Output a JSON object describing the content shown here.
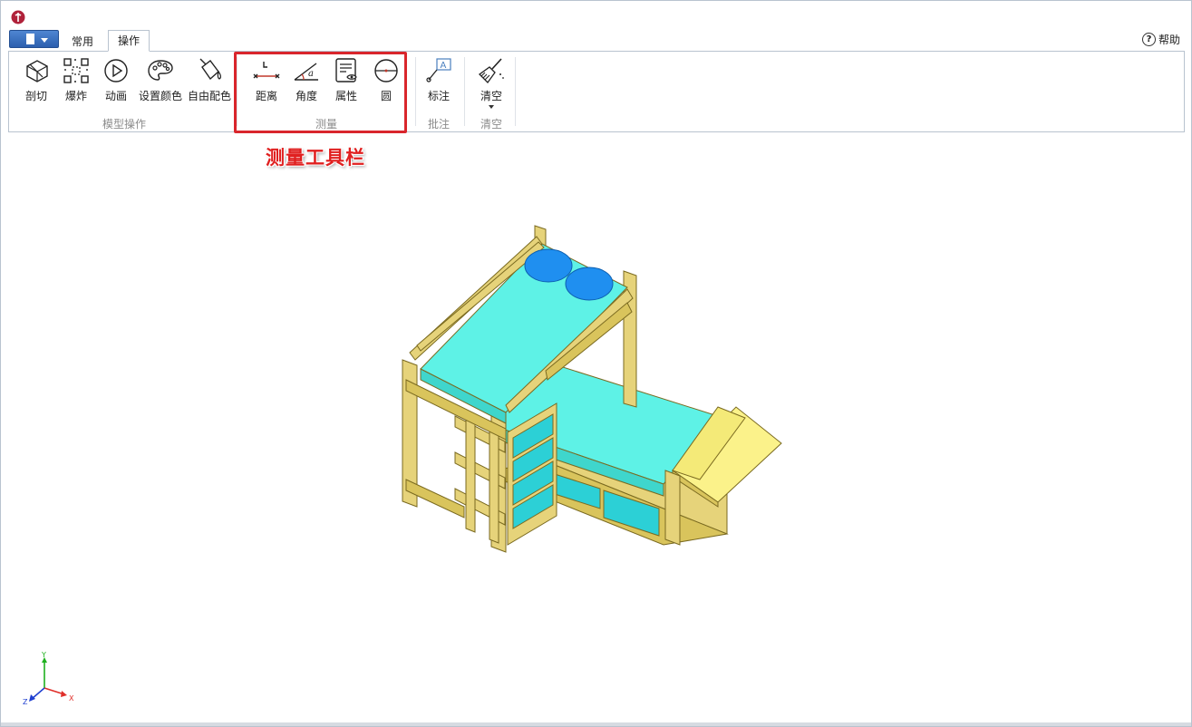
{
  "tabs": [
    {
      "label": "常用",
      "active": false
    },
    {
      "label": "操作",
      "active": true
    }
  ],
  "help": {
    "label": "帮助"
  },
  "ribbon": {
    "groups": [
      {
        "label": "模型操作"
      },
      {
        "label": "测量"
      },
      {
        "label": "批注"
      },
      {
        "label": "清空"
      }
    ],
    "tools": [
      {
        "label": "剖切",
        "icon": "section-cut-icon"
      },
      {
        "label": "爆炸",
        "icon": "explode-icon"
      },
      {
        "label": "动画",
        "icon": "play-icon"
      },
      {
        "label": "设置颜色",
        "icon": "palette-icon"
      },
      {
        "label": "自由配色",
        "icon": "paint-bucket-icon"
      },
      {
        "label": "距离",
        "icon": "distance-icon"
      },
      {
        "label": "角度",
        "icon": "angle-icon"
      },
      {
        "label": "属性",
        "icon": "properties-icon"
      },
      {
        "label": "圆",
        "icon": "circle-icon"
      },
      {
        "label": "标注",
        "icon": "annotation-icon"
      },
      {
        "label": "清空",
        "icon": "broom-icon"
      }
    ]
  },
  "annotation": {
    "text": "测量工具栏",
    "color": "#e02020"
  },
  "axes": {
    "x": "X",
    "y": "Y",
    "z": "Z"
  },
  "colors": {
    "frame": "#e6d37a",
    "mattress": "#5ef2e6",
    "pillow": "#1f8ff0",
    "drawer": "#2cd0d6",
    "highlight": "#d9262c"
  }
}
